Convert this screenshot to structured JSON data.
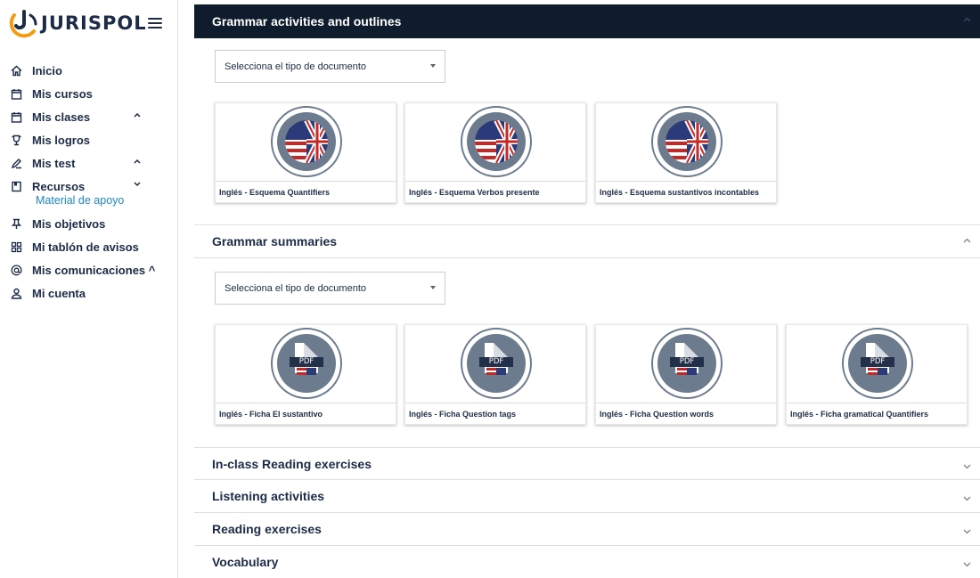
{
  "brand": {
    "name": "JURISPOL",
    "accent": "#f39c12",
    "primary": "#1c2b48",
    "link": "#1e88c8"
  },
  "sidebar": {
    "items": [
      {
        "label": "Inicio",
        "icon": "home-icon",
        "chevron": ""
      },
      {
        "label": "Mis cursos",
        "icon": "calendar-icon",
        "chevron": ""
      },
      {
        "label": "Mis clases",
        "icon": "calendar-icon",
        "chevron": "^"
      },
      {
        "label": "Mis logros",
        "icon": "trophy-icon",
        "chevron": ""
      },
      {
        "label": "Mis test",
        "icon": "pencil-icon",
        "chevron": "^"
      },
      {
        "label": "Recursos",
        "icon": "book-icon",
        "chevron": "v"
      },
      {
        "label": "Mis objetivos",
        "icon": "pin-icon",
        "chevron": ""
      },
      {
        "label": "Mi tablón de avisos",
        "icon": "grid-icon",
        "chevron": ""
      },
      {
        "label": "Mis comunicaciones ^",
        "icon": "at-icon",
        "chevron": ""
      },
      {
        "label": "Mi cuenta",
        "icon": "user-icon",
        "chevron": ""
      }
    ],
    "subitem": "Material de apoyo"
  },
  "sections": {
    "grammar_activities": {
      "title": "Grammar activities and outlines",
      "select": "Selecciona el tipo de documento",
      "cards": [
        "Inglés - Esquema Quantifiers",
        "Inglés - Esquema Verbos presente",
        "Inglés - Esquema sustantivos incontables"
      ]
    },
    "grammar_summaries": {
      "title": "Grammar summaries",
      "select": "Selecciona el tipo de documento",
      "pdf_label": "PDF",
      "cards": [
        "Inglés - Ficha El sustantivo",
        "Inglés - Ficha Question tags",
        "Inglés - Ficha Question words",
        "Inglés - Ficha gramatical Quantifiers"
      ]
    },
    "collapsed": [
      "In-class Reading exercises",
      "Listening activities",
      "Reading exercises",
      "Vocabulary"
    ]
  }
}
